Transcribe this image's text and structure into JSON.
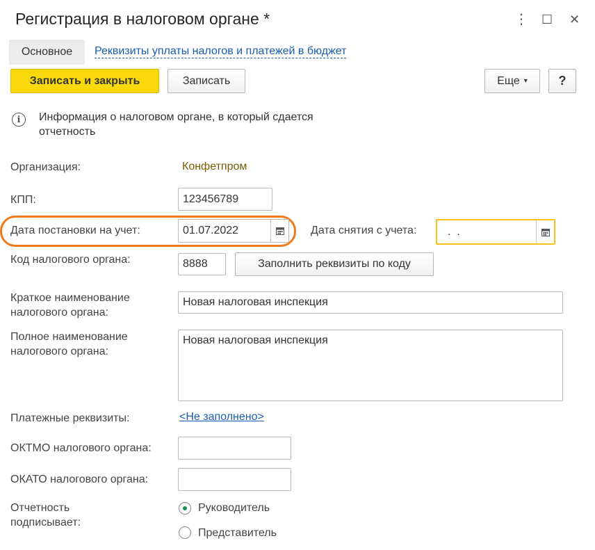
{
  "window": {
    "title": "Регистрация в налоговом органе *",
    "menu_glyph": "⋮",
    "maximize_glyph": "☐",
    "close_glyph": "✕"
  },
  "tabs": {
    "main": "Основное",
    "payment_details": "Реквизиты уплаты налогов и платежей в бюджет"
  },
  "toolbar": {
    "save_close": "Записать и закрыть",
    "save": "Записать",
    "more": "Еще",
    "more_caret": "▾",
    "help": "?"
  },
  "info": {
    "icon_glyph": "i",
    "text": "Информация о налоговом органе, в который сдается отчетность"
  },
  "form": {
    "organization": {
      "label": "Организация:",
      "value": "Конфетпром"
    },
    "kpp": {
      "label": "КПП:",
      "value": "123456789"
    },
    "registration_date": {
      "label": "Дата постановки на учет:",
      "value": "01.07.2022"
    },
    "deregistration_date": {
      "label": "Дата снятия с учета:",
      "value": "  .  ."
    },
    "tax_office_code": {
      "label": "Код налогового органа:",
      "value": "8888",
      "fill_button": "Заполнить реквизиты по коду"
    },
    "short_name": {
      "label": "Краткое наименование налогового органа:",
      "value": "Новая налоговая инспекция"
    },
    "full_name": {
      "label": "Полное наименование налогового органа:",
      "value": "Новая налоговая инспекция"
    },
    "payment_details": {
      "label": "Платежные реквизиты:",
      "link": "<Не заполнено>"
    },
    "oktmo": {
      "label": "ОКТМО налогового органа:",
      "value": ""
    },
    "okato": {
      "label": "ОКАТО налогового органа:",
      "value": ""
    },
    "signer": {
      "label": "Отчетность подписывает:",
      "options": [
        "Руководитель",
        "Представитель"
      ],
      "selected": "Руководитель"
    }
  },
  "colors": {
    "primary_button": "#f9d909",
    "link": "#1a5cb2",
    "highlight_orange": "#f07a1c",
    "highlight_yellow": "#f4c21b",
    "radio_selected": "#1c8f4c"
  }
}
